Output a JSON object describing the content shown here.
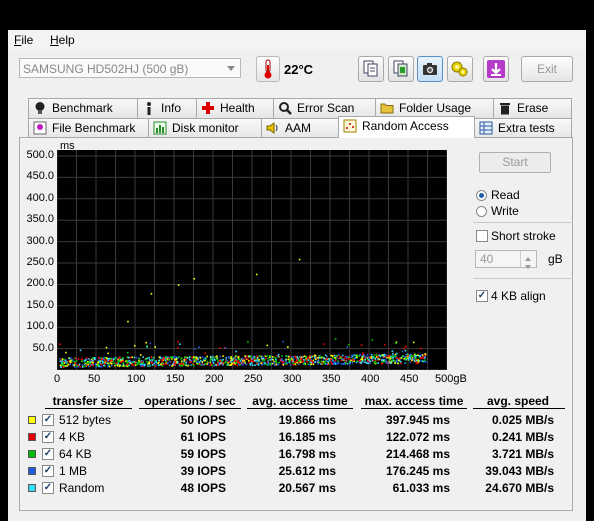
{
  "menu": {
    "file": "File",
    "file_u": "F",
    "file_rest": "ile",
    "help": "Help",
    "help_u": "H",
    "help_rest": "elp"
  },
  "toolbar": {
    "drive": "SAMSUNG HD502HJ (500 gB)",
    "temperature": "22°C",
    "exit": "Exit"
  },
  "tabs_row1": [
    "Benchmark",
    "Info",
    "Health",
    "Error Scan",
    "Folder Usage",
    "Erase"
  ],
  "tabs_row2": [
    "File Benchmark",
    "Disk monitor",
    "AAM",
    "Random Access",
    "Extra tests"
  ],
  "chart": {
    "unit_y": "ms",
    "y_ticks": [
      "500.0",
      "450.0",
      "400.0",
      "350.0",
      "300.0",
      "250.0",
      "200.0",
      "150.0",
      "100.0",
      "50.0"
    ],
    "x_ticks": [
      "0",
      "50",
      "100",
      "150",
      "200",
      "250",
      "300",
      "350",
      "400",
      "450",
      "500gB"
    ]
  },
  "chart_data": {
    "type": "scatter",
    "xlabel": "",
    "ylabel": "ms",
    "xlim": [
      0,
      500
    ],
    "ylim": [
      0,
      500
    ],
    "series": [
      {
        "name": "512 bytes",
        "color": "#ffff00"
      },
      {
        "name": "4 KB",
        "color": "#ff0000"
      },
      {
        "name": "64 KB",
        "color": "#00cc00"
      },
      {
        "name": "1 MB",
        "color": "#1e5fe0"
      },
      {
        "name": "Random",
        "color": "#33e0ff"
      }
    ]
  },
  "controls": {
    "start": "Start",
    "read": "Read",
    "write": "Write",
    "short_stroke": "Short stroke",
    "stroke_value": "40",
    "stroke_unit": "gB",
    "align": "4 KB align"
  },
  "table": {
    "headers": [
      "transfer size",
      "operations / sec",
      "avg. access time",
      "max. access time",
      "avg. speed"
    ],
    "rows": [
      {
        "name": "512 bytes",
        "color": "#ffff00",
        "ops": "50 IOPS",
        "avg": "19.866 ms",
        "max": "397.945 ms",
        "speed": "0.025 MB/s"
      },
      {
        "name": "4 KB",
        "color": "#e00000",
        "ops": "61 IOPS",
        "avg": "16.185 ms",
        "max": "122.072 ms",
        "speed": "0.241 MB/s"
      },
      {
        "name": "64 KB",
        "color": "#00c000",
        "ops": "59 IOPS",
        "avg": "16.798 ms",
        "max": "214.468 ms",
        "speed": "3.721 MB/s"
      },
      {
        "name": "1 MB",
        "color": "#1e5fe0",
        "ops": "39 IOPS",
        "avg": "25.612 ms",
        "max": "176.245 ms",
        "speed": "39.043 MB/s"
      },
      {
        "name": "Random",
        "color": "#33e0ff",
        "ops": "48 IOPS",
        "avg": "20.567 ms",
        "max": "61.033 ms",
        "speed": "24.670 MB/s"
      }
    ]
  }
}
